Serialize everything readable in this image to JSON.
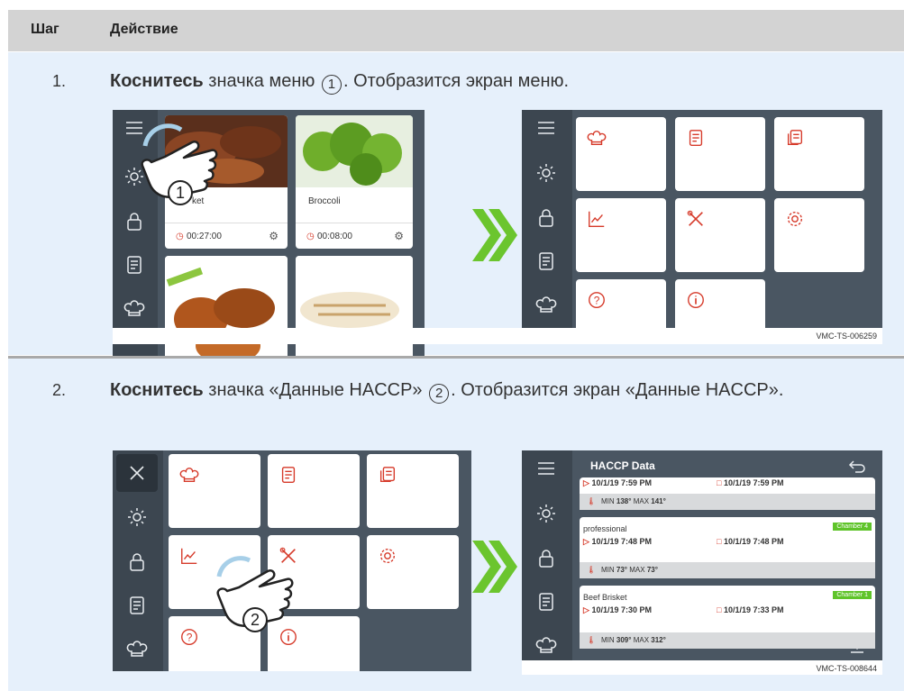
{
  "table": {
    "col_step": "Шаг",
    "col_action": "Действие"
  },
  "steps": [
    {
      "number": "1.",
      "verb": "Коснитесь",
      "text_a": " значка меню ",
      "callout": "1",
      "text_b": ". Отобразится экран меню.",
      "image_code": "VMC-TS-006259"
    },
    {
      "number": "2.",
      "verb": "Коснитесь",
      "text_a": " значка «Данные HACCP» ",
      "callout": "2",
      "text_b": ". Отобразится экран «Данные HACCP».",
      "image_code": "VMC-TS-008644"
    }
  ],
  "shot1": {
    "recipes": [
      {
        "name": "Brisket",
        "name_visible": "ket",
        "timer": "00:27:00"
      },
      {
        "name": "Broccoli",
        "timer": "00:08:00"
      }
    ]
  },
  "haccp": {
    "title": "HACCP Data",
    "entries": [
      {
        "name": "",
        "start": "10/1/19 7:59 PM",
        "end": "10/1/19 7:59 PM",
        "min_label": "MIN",
        "min": "138°",
        "max_label": "MAX",
        "max": "141°",
        "chamber": ""
      },
      {
        "name": "professional",
        "start": "10/1/19 7:48 PM",
        "end": "10/1/19 7:48 PM",
        "min_label": "MIN",
        "min": "73°",
        "max_label": "MAX",
        "max": "73°",
        "chamber": "Chamber 4"
      },
      {
        "name": "Beef Brisket",
        "start": "10/1/19 7:30 PM",
        "end": "10/1/19 7:33 PM",
        "min_label": "MIN",
        "min": "309°",
        "max_label": "MAX",
        "max": "312°",
        "chamber": "Chamber 1"
      }
    ]
  },
  "colors": {
    "accent": "#d63a2a",
    "green": "#5fc42a",
    "panel": "#4a5662",
    "sidebar": "#3c4650",
    "row_bg": "#e6f0fb"
  }
}
